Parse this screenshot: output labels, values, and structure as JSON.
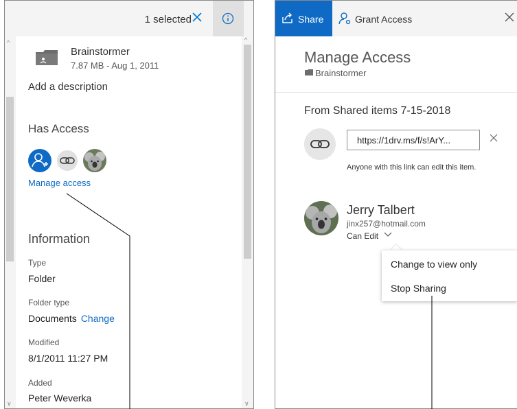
{
  "details_pane": {
    "selection_text": "1 selected",
    "folder": {
      "name": "Brainstormer",
      "meta": "7.87 MB - Aug 1, 2011"
    },
    "add_description": "Add a description",
    "has_access_heading": "Has Access",
    "manage_access_link": "Manage access",
    "information_heading": "Information",
    "fields": [
      {
        "label": "Type",
        "value": "Folder"
      },
      {
        "label": "Folder type",
        "value": "Documents",
        "action": "Change"
      },
      {
        "label": "Modified",
        "value": "8/1/2011 11:27 PM"
      },
      {
        "label": "Added",
        "value": "Peter Weverka"
      }
    ]
  },
  "share_pane": {
    "share_label": "Share",
    "grant_access_label": "Grant Access",
    "title": "Manage Access",
    "subtitle": "Brainstormer",
    "shared_link_heading": "From Shared items 7-15-2018",
    "link_value": "https://1drv.ms/f/s!ArY...",
    "link_description": "Anyone with this link can edit this item.",
    "person": {
      "name": "Jerry Talbert",
      "email": "jinx257@hotmail.com",
      "permission": "Can Edit"
    },
    "permission_menu": [
      "Change to view only",
      "Stop Sharing"
    ]
  },
  "colors": {
    "accent": "#0e6ac4",
    "header_bg": "#f4f4f4",
    "info_button_bg": "#e0e0e0"
  },
  "icons": [
    "close-icon",
    "info-icon",
    "folder-icon",
    "add-person-icon",
    "link-icon",
    "share-icon",
    "grant-access-icon",
    "chevron-down-icon"
  ]
}
